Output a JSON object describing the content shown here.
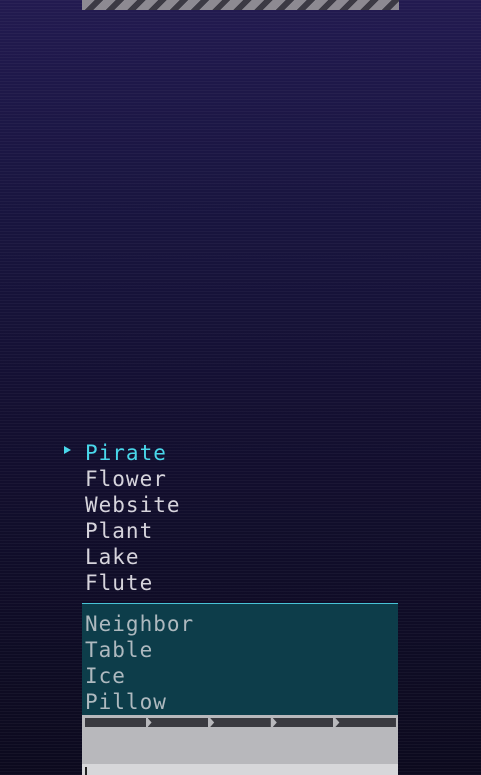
{
  "menu": {
    "items": [
      {
        "label": "Pirate",
        "selected": true
      },
      {
        "label": "Flower",
        "selected": false
      },
      {
        "label": "Website",
        "selected": false
      },
      {
        "label": "Plant",
        "selected": false
      },
      {
        "label": "Lake",
        "selected": false
      },
      {
        "label": "Flute",
        "selected": false
      }
    ]
  },
  "panel": {
    "items": [
      {
        "label": "Neighbor"
      },
      {
        "label": "Table"
      },
      {
        "label": "Ice"
      },
      {
        "label": "Pillow"
      }
    ]
  },
  "colors": {
    "background_top": "#221a50",
    "background_bottom": "#0c0a1e",
    "selected_text": "#49d7ea",
    "normal_text": "#d6d4dc",
    "panel_background": "#0d3d4a",
    "panel_text": "#aeb9bf",
    "footer_background": "#b8b8bc",
    "segment_color": "#3a3a40"
  },
  "icons": {
    "cursor": "selection-arrow-icon"
  }
}
